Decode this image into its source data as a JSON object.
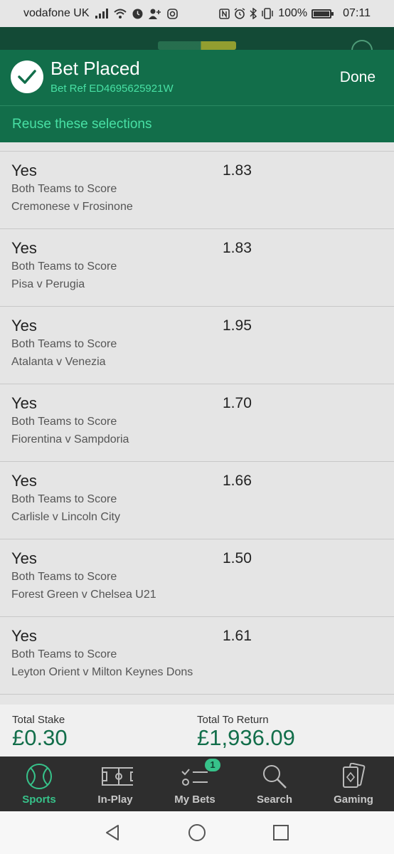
{
  "status_bar": {
    "carrier": "vodafone UK",
    "battery": "100%",
    "time": "07:11",
    "battery_level": 1.0,
    "icons": [
      "signal-icon",
      "wifi-icon",
      "alarm-icon",
      "person-add-icon",
      "instagram-icon",
      "nfc-icon",
      "alarm-clock-icon",
      "bluetooth-icon",
      "vibrate-icon",
      "battery-icon"
    ]
  },
  "header": {
    "title": "Bet Placed",
    "bet_ref": "Bet Ref ED4695625921W",
    "done_label": "Done",
    "icon": "check-icon"
  },
  "reuse_label": "Reuse these selections",
  "selections": [
    {
      "pick": "Yes",
      "market": "Both Teams to Score",
      "event": "Cremonese v Frosinone",
      "odds": "1.83"
    },
    {
      "pick": "Yes",
      "market": "Both Teams to Score",
      "event": "Pisa v Perugia",
      "odds": "1.83"
    },
    {
      "pick": "Yes",
      "market": "Both Teams to Score",
      "event": "Atalanta v Venezia",
      "odds": "1.95"
    },
    {
      "pick": "Yes",
      "market": "Both Teams to Score",
      "event": "Fiorentina v Sampdoria",
      "odds": "1.70"
    },
    {
      "pick": "Yes",
      "market": "Both Teams to Score",
      "event": "Carlisle v Lincoln City",
      "odds": "1.66"
    },
    {
      "pick": "Yes",
      "market": "Both Teams to Score",
      "event": "Forest Green v Chelsea U21",
      "odds": "1.50"
    },
    {
      "pick": "Yes",
      "market": "Both Teams to Score",
      "event": "Leyton Orient v Milton Keynes Dons",
      "odds": "1.61"
    }
  ],
  "totals": {
    "stake_label": "Total Stake",
    "stake_value": "£0.30",
    "return_label": "Total To Return",
    "return_value": "£1,936.09"
  },
  "bottom_nav": {
    "items": [
      {
        "label": "Sports",
        "icon": "tennis-ball-icon",
        "active": true
      },
      {
        "label": "In-Play",
        "icon": "pitch-icon",
        "active": false
      },
      {
        "label": "My Bets",
        "icon": "bet-list-icon",
        "active": false,
        "badge": "1"
      },
      {
        "label": "Search",
        "icon": "search-icon",
        "active": false
      },
      {
        "label": "Gaming",
        "icon": "cards-icon",
        "active": false
      }
    ]
  },
  "system_nav": [
    "back-icon",
    "home-icon",
    "recents-icon"
  ],
  "colors": {
    "brand_green": "#126e4a",
    "accent_green": "#48e0a4",
    "nav_background": "#2e2e2e",
    "active_nav": "#37c28a"
  }
}
